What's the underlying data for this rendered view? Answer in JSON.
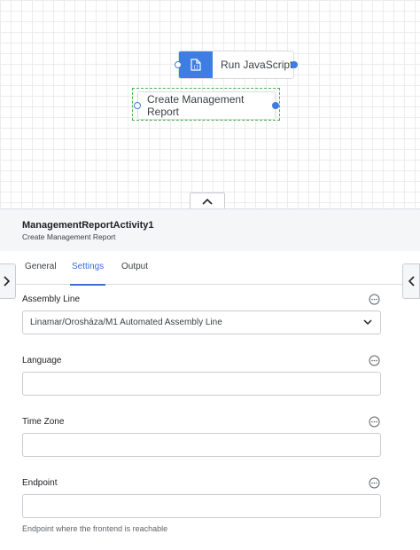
{
  "canvas": {
    "nodes": [
      {
        "label": "Run JavaScript",
        "icon": "script-icon",
        "accent": "#3d7de4"
      },
      {
        "label": "Create Management Report",
        "selected": true
      }
    ]
  },
  "panel": {
    "title": "ManagementReportActivity1",
    "subtitle": "Create Management Report",
    "tabs": [
      {
        "label": "General"
      },
      {
        "label": "Settings",
        "active": true
      },
      {
        "label": "Output"
      }
    ],
    "fields": [
      {
        "label": "Assembly Line",
        "type": "select",
        "value": "Linamar/Orosháza/M1 Automated Assembly Line"
      },
      {
        "label": "Language",
        "type": "text",
        "value": ""
      },
      {
        "label": "Time Zone",
        "type": "text",
        "value": ""
      },
      {
        "label": "Endpoint",
        "type": "text",
        "value": "",
        "hint": "Endpoint where the frontend is reachable"
      }
    ]
  },
  "colors": {
    "accent": "#3d6fd1",
    "node_accent": "#3d7de4",
    "selection": "#4caf50"
  }
}
